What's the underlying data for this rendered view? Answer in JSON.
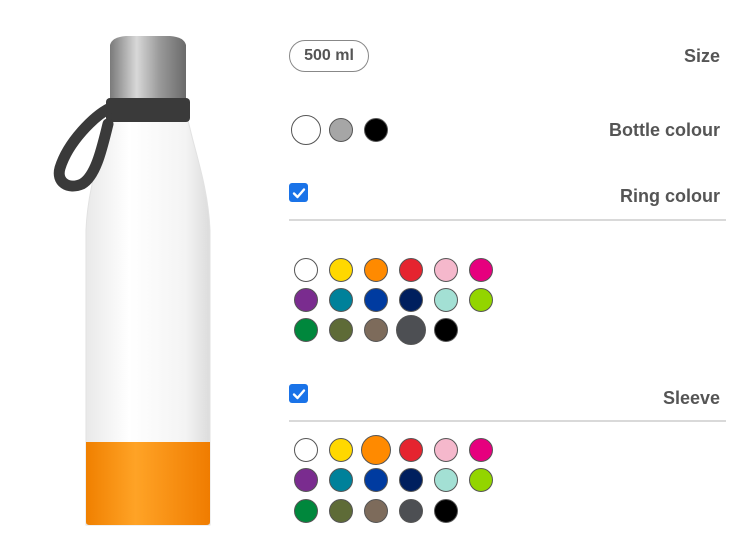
{
  "product": {
    "image_name": "water-bottle-preview",
    "colors": {
      "body": "#ffffff",
      "cap": "#b0b0b0",
      "strap": "#3a3a3a",
      "sleeve": "#ff8a00"
    }
  },
  "size": {
    "label": "Size",
    "selected": "500 ml"
  },
  "bottle_colour": {
    "label": "Bottle colour",
    "swatches": [
      "#ffffff",
      "#a6a6a6",
      "#000000"
    ]
  },
  "ring_colour": {
    "label": "Ring colour",
    "checked": true,
    "swatches": [
      "#ffffff",
      "#ffd800",
      "#ff8a00",
      "#e5242f",
      "#f5b8cc",
      "#e6007e",
      "#7a2c8f",
      "#00819a",
      "#003ba0",
      "#001f5e",
      "#a3e0d4",
      "#93d500",
      "#00873c",
      "#5e6b37",
      "#7d6b5b",
      "#4d4f53",
      "#000000"
    ],
    "selected_index": 15
  },
  "sleeve": {
    "label": "Sleeve",
    "checked": true,
    "swatches": [
      "#ffffff",
      "#ffd800",
      "#ff8a00",
      "#e5242f",
      "#f5b8cc",
      "#e6007e",
      "#7a2c8f",
      "#00819a",
      "#003ba0",
      "#001f5e",
      "#a3e0d4",
      "#93d500",
      "#00873c",
      "#5e6b37",
      "#7d6b5b",
      "#4d4f53",
      "#000000"
    ],
    "selected_index": 2
  }
}
